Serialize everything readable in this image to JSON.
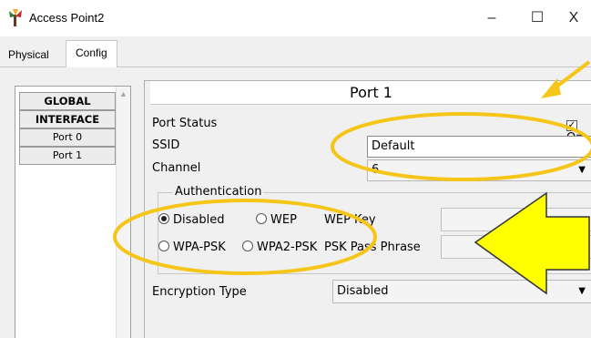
{
  "window": {
    "title": "Access Point2",
    "minimize_glyph": "–",
    "maximize_glyph": "☐",
    "close_glyph": "X",
    "icon": "access-point-icon"
  },
  "tabs": [
    {
      "label": "Physical",
      "selected": false
    },
    {
      "label": "Config",
      "selected": true
    }
  ],
  "sidebar": {
    "items": [
      {
        "label": "GLOBAL",
        "bold": true
      },
      {
        "label": "INTERFACE",
        "bold": true
      },
      {
        "label": "Port 0",
        "bold": false
      },
      {
        "label": "Port 1",
        "bold": false
      }
    ]
  },
  "panel": {
    "title": "Port 1",
    "port_status_label": "Port Status",
    "port_status_checkbox_label": "On",
    "port_status_checked": true,
    "ssid_label": "SSID",
    "ssid_value": "Default",
    "channel_label": "Channel",
    "channel_value": "6",
    "authentication": {
      "legend": "Authentication",
      "options": [
        {
          "label": "Disabled",
          "selected": true
        },
        {
          "label": "WEP",
          "selected": false
        },
        {
          "label": "WPA-PSK",
          "selected": false
        },
        {
          "label": "WPA2-PSK",
          "selected": false
        }
      ],
      "wep_key_label": "WEP Key",
      "psk_label": "PSK Pass Phrase"
    },
    "encryption_label": "Encryption Type",
    "encryption_value": "Disabled"
  },
  "annotations": {
    "highlight_color": "#f5c518",
    "arrow_fill": "#ffff00",
    "arrow_stroke": "#333333"
  }
}
